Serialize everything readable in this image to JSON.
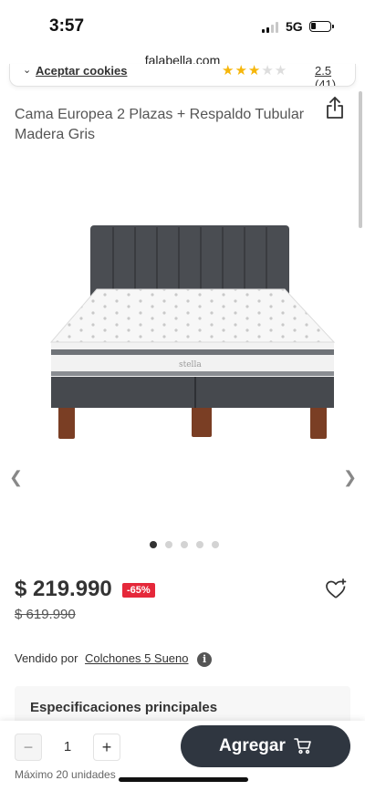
{
  "status": {
    "time": "3:57",
    "network": "5G"
  },
  "browser": {
    "url": "falabella.com"
  },
  "cookie_bar": {
    "link": "Aceptar cookies",
    "rating_text": "2.5 (41)",
    "rating_value": 2.5
  },
  "product": {
    "title": "Cama Europea 2 Plazas + Respaldo Tubular Madera Gris",
    "brand_text": "stella",
    "price": "$ 219.990",
    "discount": "-65%",
    "old_price": "$ 619.990",
    "seller_label": "Vendido por",
    "seller_name": "Colchones 5 Sueno",
    "info_glyph": "i"
  },
  "gallery": {
    "images": 5,
    "active_index": 0
  },
  "specs": {
    "title": "Especificaciones principales"
  },
  "cart": {
    "quantity": "1",
    "minus": "−",
    "plus": "+",
    "max_units": "Máximo 20 unidades",
    "add_label": "Agregar"
  },
  "icons": [
    "share-icon",
    "wishlist-heart-icon",
    "chevron-left-icon",
    "chevron-right-icon",
    "info-icon",
    "cart-icon"
  ],
  "colors": {
    "discount_badge": "#e5283a",
    "add_button": "#2f3640",
    "stars": "#f6b60a"
  }
}
